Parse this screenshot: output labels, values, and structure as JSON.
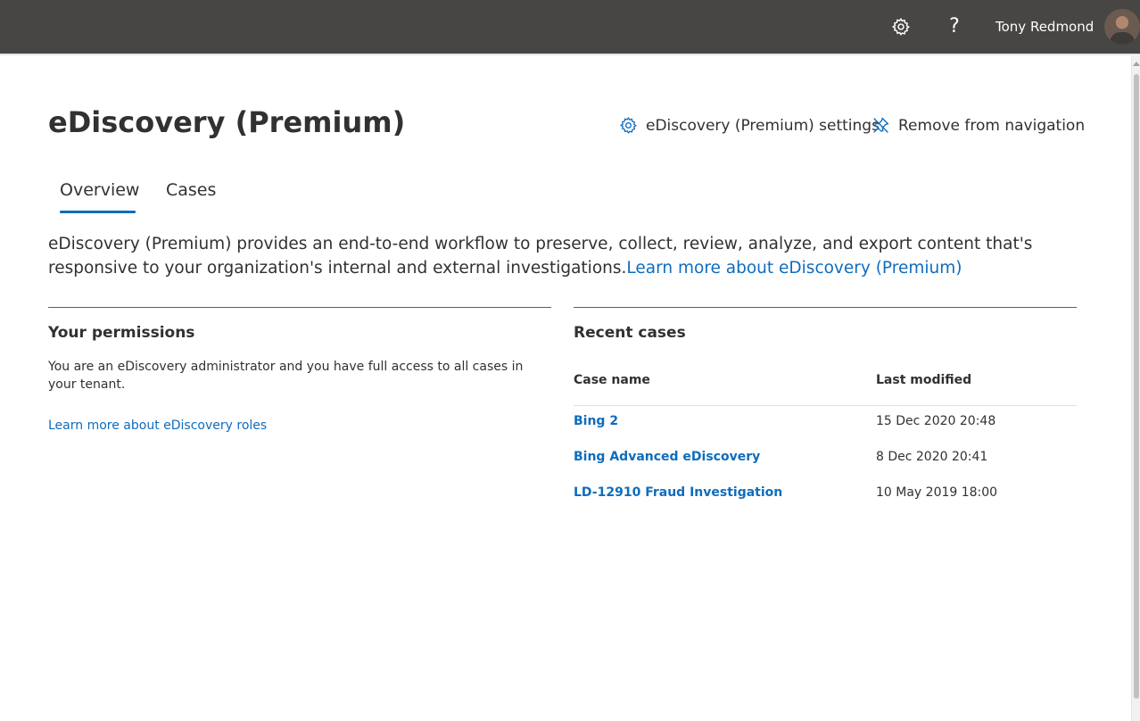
{
  "topbar": {
    "settings_icon": "gear-icon",
    "help_icon": "question-icon",
    "help_glyph": "?",
    "user_name": "Tony Redmond",
    "avatar_icon": "user-avatar"
  },
  "header": {
    "title": "eDiscovery (Premium)",
    "settings_label": "eDiscovery (Premium) settings",
    "settings_icon": "gear-icon",
    "remove_nav_label": "Remove from navigation",
    "remove_nav_icon": "unpin-icon"
  },
  "tabs": [
    {
      "label": "Overview",
      "selected": true
    },
    {
      "label": "Cases",
      "selected": false
    }
  ],
  "description": {
    "text": "eDiscovery (Premium) provides an end-to-end workflow to preserve, collect, review, analyze, and export content that's responsive to your organization's internal and external investigations.",
    "link_label": "Learn more about eDiscovery (Premium)"
  },
  "permissions": {
    "title": "Your permissions",
    "text": "You are an eDiscovery administrator and you have full access to all cases in your tenant.",
    "link_label": "Learn more about eDiscovery roles"
  },
  "recent_cases": {
    "title": "Recent cases",
    "columns": {
      "name": "Case name",
      "modified": "Last modified"
    },
    "rows": [
      {
        "name": "Bing 2",
        "modified": "15 Dec 2020 20:48"
      },
      {
        "name": "Bing Advanced eDiscovery",
        "modified": "8 Dec 2020 20:41"
      },
      {
        "name": "LD-12910 Fraud Investigation",
        "modified": "10 May 2019 18:00"
      }
    ]
  },
  "colors": {
    "topbar": "#484644",
    "accent": "#0f6cbd",
    "text": "#323130"
  }
}
